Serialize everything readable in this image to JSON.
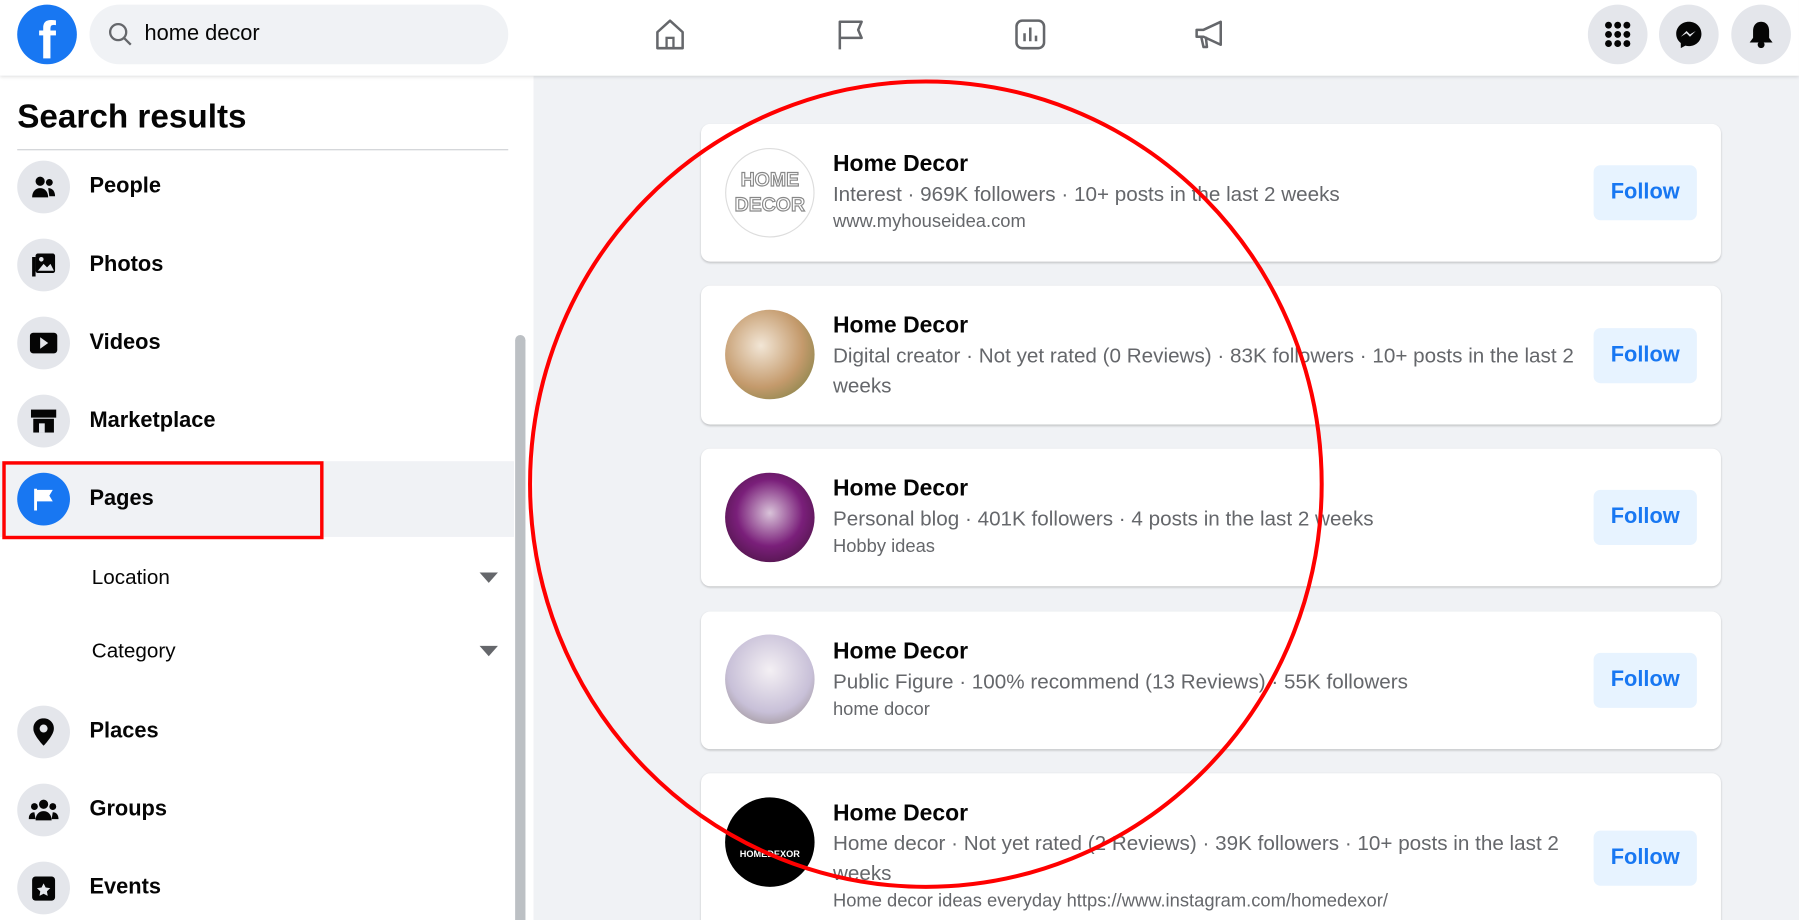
{
  "header": {
    "search_value": "home decor",
    "logo": "facebook-logo",
    "nav_icons": [
      "home-icon",
      "flag-icon",
      "insights-icon",
      "megaphone-icon"
    ],
    "right_icons": [
      "menu-grid-icon",
      "messenger-icon",
      "bell-icon"
    ]
  },
  "sidebar": {
    "title": "Search results",
    "items": [
      {
        "label": "People",
        "icon": "people-icon"
      },
      {
        "label": "Photos",
        "icon": "photos-icon"
      },
      {
        "label": "Videos",
        "icon": "video-icon"
      },
      {
        "label": "Marketplace",
        "icon": "marketplace-icon"
      },
      {
        "label": "Pages",
        "icon": "flag-icon",
        "active": true
      },
      {
        "label": "Places",
        "icon": "pin-icon"
      },
      {
        "label": "Groups",
        "icon": "groups-icon"
      },
      {
        "label": "Events",
        "icon": "events-icon"
      }
    ],
    "filters": [
      {
        "label": "Location"
      },
      {
        "label": "Category"
      }
    ]
  },
  "results": [
    {
      "title": "Home Decor",
      "meta": "Interest · 969K followers · 10+ posts in the last 2 weeks",
      "extra": "www.myhouseidea.com",
      "button": "Follow"
    },
    {
      "title": "Home Decor",
      "meta": "Digital creator · Not yet rated (0 Reviews) · 83K followers · 10+ posts in the last 2 weeks",
      "extra": "",
      "button": "Follow"
    },
    {
      "title": "Home Decor",
      "meta": "Personal blog · 401K followers · 4 posts in the last 2 weeks",
      "extra": "Hobby ideas",
      "button": "Follow"
    },
    {
      "title": "Home Decor",
      "meta": "Public Figure · 100% recommend (13 Reviews) · 55K followers",
      "extra": "home docor",
      "button": "Follow"
    },
    {
      "title": "Home Decor",
      "meta": "Home decor · Not yet rated (2 Reviews) · 39K followers · 10+ posts in the last 2 weeks",
      "extra": "Home decor ideas everyday https://www.instagram.com/homedexor/",
      "button": "Follow"
    }
  ],
  "avatar_text": {
    "first": "HOME DECOR",
    "last": "HOMEDEXOR"
  },
  "colors": {
    "brand": "#1877f2",
    "annotation": "#ff0000"
  }
}
